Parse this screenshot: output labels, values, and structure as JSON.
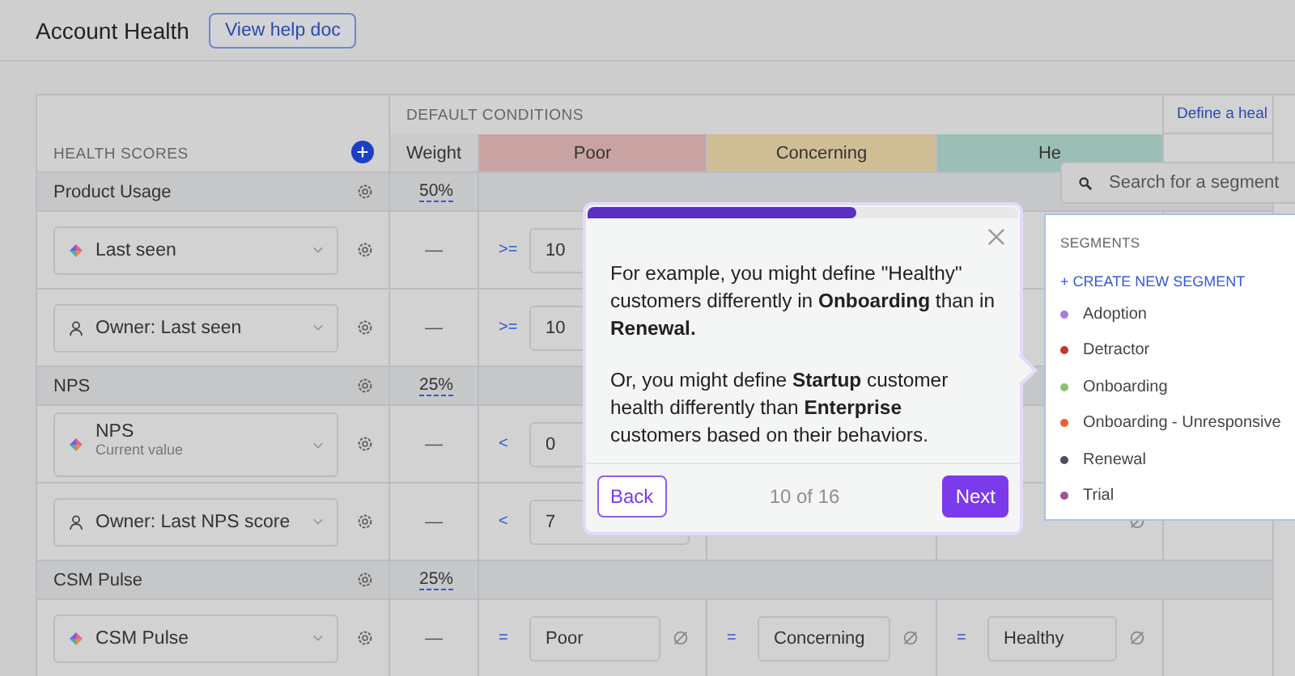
{
  "header": {
    "title": "Account Health",
    "help_button": "View help doc"
  },
  "table": {
    "section_label": "DEFAULT CONDITIONS",
    "scores_label": "HEALTH SCORES",
    "weight_label": "Weight",
    "extra_column": "Define a heal",
    "conditions": [
      {
        "label": "Poor",
        "color": "#c9a2a2"
      },
      {
        "label": "Concerning",
        "color": "#cfbd95"
      },
      {
        "label": "He",
        "color": "#9bbeb5"
      }
    ],
    "rows": [
      {
        "kind": "group",
        "name": "Product Usage",
        "weight": "50%"
      },
      {
        "kind": "metric",
        "name": "Last seen",
        "weight": "—",
        "cells": [
          {
            "operator": ">=",
            "value": "10"
          },
          null,
          null
        ]
      },
      {
        "kind": "owner_metric",
        "name": "Owner: Last seen",
        "weight": "—",
        "cells": [
          {
            "operator": ">=",
            "value": "10"
          },
          null,
          null
        ]
      },
      {
        "kind": "group",
        "name": "NPS",
        "weight": "25%"
      },
      {
        "kind": "metric",
        "name": "NPS",
        "subtitle": "Current value",
        "weight": "—",
        "cells": [
          {
            "operator": "<",
            "value": "0"
          },
          null,
          null
        ]
      },
      {
        "kind": "owner_metric",
        "name": "Owner: Last NPS score",
        "weight": "—",
        "cells": [
          {
            "operator": "<",
            "value": "7"
          },
          null,
          {
            "clear_icon": true
          }
        ]
      },
      {
        "kind": "group",
        "name": "CSM Pulse",
        "weight": "25%"
      },
      {
        "kind": "metric",
        "name": "CSM Pulse",
        "weight": "—",
        "cells": [
          {
            "operator": "=",
            "value": "Poor",
            "clear_icon": true
          },
          {
            "operator": "=",
            "value": "Concerning",
            "clear_icon": true
          },
          {
            "operator": "=",
            "value": "Healthy",
            "clear_icon": true
          }
        ]
      }
    ]
  },
  "tour_popover": {
    "level": 0.625,
    "paragraphs": [
      "For example, you might define \"Healthy\" customers differently in **Onboarding** than in **Renewal.**",
      "Or, you might define **Startup** customer health differently than **Enterprise** customers based on their behaviors."
    ],
    "back": "Back",
    "step": "10 of 16",
    "next": "Next"
  },
  "segment_picker": {
    "placeholder": "Search for a segment",
    "heading": "SEGMENTS",
    "create": "+ CREATE NEW SEGMENT",
    "segments": [
      {
        "name": "Adoption",
        "color": "#a57de6"
      },
      {
        "name": "Detractor",
        "color": "#c0392b"
      },
      {
        "name": "Onboarding",
        "color": "#8cc26b"
      },
      {
        "name": "Onboarding - Unresponsive",
        "color": "#e8622c"
      },
      {
        "name": "Renewal",
        "color": "#4a4f5c"
      },
      {
        "name": "Trial",
        "color": "#a4518f"
      }
    ]
  }
}
